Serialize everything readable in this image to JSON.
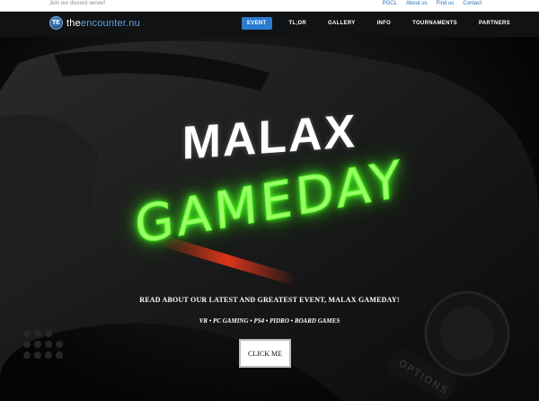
{
  "topbar": {
    "discord": "Join our discord server!",
    "links": [
      "PGCL",
      "About us",
      "Find us",
      "Contact"
    ]
  },
  "logo": {
    "mark": "TE",
    "text_prefix": "the",
    "text_main": "encounter",
    "text_suffix": ".nu"
  },
  "nav": {
    "items": [
      "EVENT",
      "TL;DR",
      "GALLERY",
      "INFO",
      "TOURNAMENTS",
      "PARTNERS"
    ],
    "active": "EVENT"
  },
  "hero": {
    "title_line1": "MALAX",
    "title_line2": "GAMEDAY",
    "tagline": "READ ABOUT OUR LATEST AND GREATEST EVENT, MALAX GAMEDAY!",
    "subline": "VR • PC GAMING • PS4 • PIDRO • BOARD GAMES",
    "cta": "CLICK ME",
    "controller_text": "OPTIONS"
  },
  "colors": {
    "accent": "#2a7bd0",
    "neon": "#5cff2a",
    "nav_bg": "#111213"
  }
}
